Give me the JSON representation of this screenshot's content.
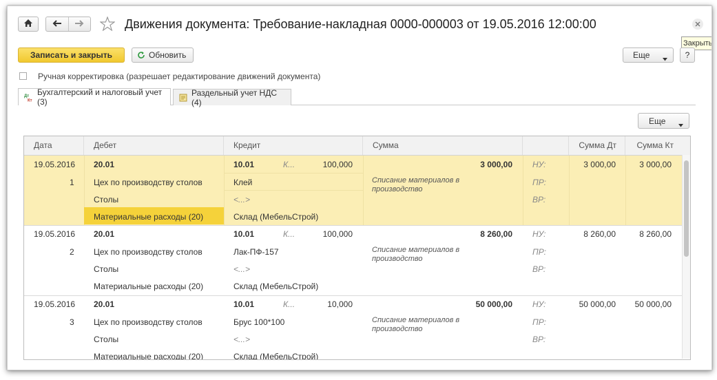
{
  "window": {
    "title": "Движения документа: Требование-накладная 0000-000003 от 19.05.2016 12:00:00",
    "close_tooltip": "Закрыть"
  },
  "icons": {
    "home": "home-icon",
    "back": "arrow-left-icon",
    "forward": "arrow-right-icon",
    "favorite": "star-icon",
    "close": "close-icon",
    "refresh": "refresh-icon",
    "dropdown": "triangle-down-icon",
    "accounting_tab": "dt-kt-icon",
    "vat_tab": "document-icon"
  },
  "toolbar": {
    "save_close_label": "Записать и закрыть",
    "refresh_label": "Обновить",
    "more_label": "Еще",
    "help_label": "?"
  },
  "manual_edit": {
    "label": "Ручная корректировка (разрешает редактирование движений документа)",
    "checked": false
  },
  "tabs": [
    {
      "label": "Бухгалтерский и налоговый учет (3)",
      "active": true
    },
    {
      "label": "Раздельный учет НДС (4)",
      "active": false
    }
  ],
  "table": {
    "more_label": "Еще",
    "columns": [
      "Дата",
      "Дебет",
      "Кредит",
      "Сумма",
      "Сумма Дт",
      "Сумма Кт"
    ],
    "rows": [
      {
        "date": "19.05.2016",
        "num": "1",
        "debit_account": "20.01",
        "debit_sub1": "Цех по производству столов",
        "debit_sub2": "Столы",
        "debit_sub3": "Материальные расходы (20)",
        "credit_account": "10.01",
        "credit_qty_label": "К...",
        "credit_qty": "100,000",
        "credit_sub1": "Клей",
        "credit_sub2": "<...>",
        "credit_sub3": "Склад (МебельСтрой)",
        "sum": "3 000,00",
        "description": "Списание материалов в производство",
        "nu_label": "НУ:",
        "pr_label": "ПР:",
        "vr_label": "ВР:",
        "sum_dt": "3 000,00",
        "sum_kt": "3 000,00"
      },
      {
        "date": "19.05.2016",
        "num": "2",
        "debit_account": "20.01",
        "debit_sub1": "Цех по производству столов",
        "debit_sub2": "Столы",
        "debit_sub3": "Материальные расходы (20)",
        "credit_account": "10.01",
        "credit_qty_label": "К...",
        "credit_qty": "100,000",
        "credit_sub1": "Лак-ПФ-157",
        "credit_sub2": "<...>",
        "credit_sub3": "Склад (МебельСтрой)",
        "sum": "8 260,00",
        "description": "Списание материалов в производство",
        "nu_label": "НУ:",
        "pr_label": "ПР:",
        "vr_label": "ВР:",
        "sum_dt": "8 260,00",
        "sum_kt": "8 260,00"
      },
      {
        "date": "19.05.2016",
        "num": "3",
        "debit_account": "20.01",
        "debit_sub1": "Цех по производству столов",
        "debit_sub2": "Столы",
        "debit_sub3": "Материальные расходы (20)",
        "credit_account": "10.01",
        "credit_qty_label": "К...",
        "credit_qty": "10,000",
        "credit_sub1": "Брус 100*100",
        "credit_sub2": "<...>",
        "credit_sub3": "Склад (МебельСтрой)",
        "sum": "50 000,00",
        "description": "Списание материалов в производство",
        "nu_label": "НУ:",
        "pr_label": "ПР:",
        "vr_label": "ВР:",
        "sum_dt": "50 000,00",
        "sum_kt": "50 000,00"
      }
    ]
  },
  "colors": {
    "accent_button": "#f7d348",
    "selection": "#fbeeb5",
    "selected_cell": "#f5d23a"
  }
}
